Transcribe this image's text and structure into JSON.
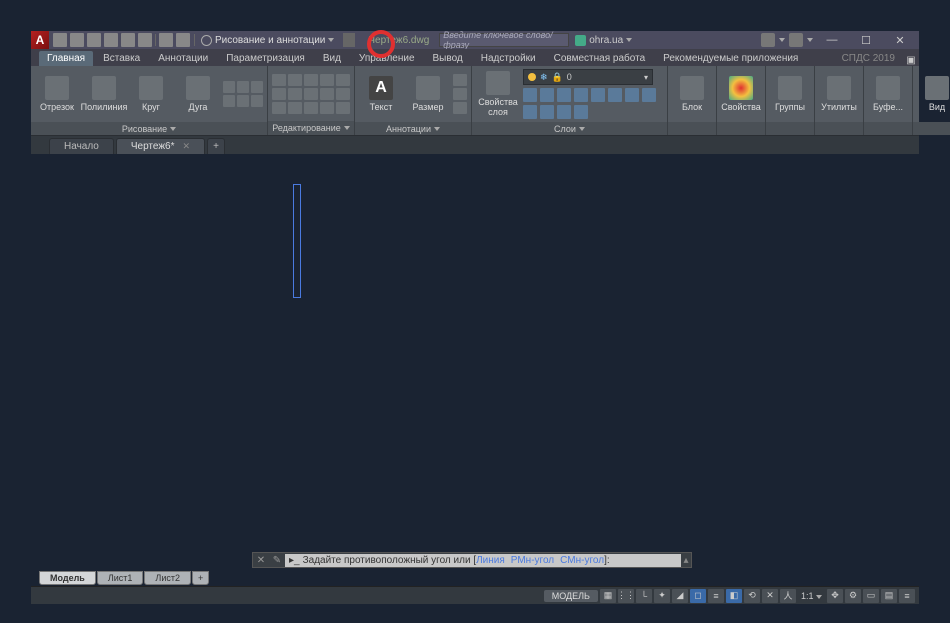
{
  "app_logo": "A",
  "workspace": "Рисование и аннотации",
  "file_name": "Чертеж6.dwg",
  "search_placeholder": "Введите ключевое слово/фразу",
  "user": "ohra.ua",
  "window_buttons": {
    "min": "—",
    "max": "☐",
    "close": "✕"
  },
  "ribbon_tabs": [
    "Главная",
    "Вставка",
    "Аннотации",
    "Параметризация",
    "Вид",
    "Управление",
    "Вывод",
    "Надстройки",
    "Совместная работа",
    "Рекомендуемые приложения"
  ],
  "ribbon_extra": "СПДС 2019",
  "panels": {
    "draw": {
      "title": "Рисование",
      "items": [
        "Отрезок",
        "Полилиния",
        "Круг",
        "Дуга"
      ]
    },
    "edit": {
      "title": "Редактирование"
    },
    "anno": {
      "title": "Аннотации",
      "items": [
        "Текст",
        "Размер"
      ]
    },
    "layer": {
      "title": "Слои",
      "prop": "Свойства слоя",
      "current": "0"
    },
    "block": {
      "title": "Блок",
      "item": "Блок"
    },
    "props": {
      "title": "Свойства",
      "item": "Свойства"
    },
    "groups": {
      "title": "Группы",
      "item": "Группы"
    },
    "utils": {
      "title": "Утилиты",
      "item": "Утилиты"
    },
    "clip": {
      "title": "Буфе...",
      "item": "Буфе..."
    },
    "view": {
      "title": "Вид",
      "item": "Вид"
    }
  },
  "doc_tabs": {
    "start": "Начало",
    "active": "Чертеж6*",
    "plus": "+"
  },
  "command": {
    "prefix": "Задайте противоположный угол или [",
    "opt1": "Линия",
    "opt2": "РМн-угол",
    "opt3": "СМн-угол",
    "suffix": "]:"
  },
  "layout_tabs": [
    "Модель",
    "Лист1",
    "Лист2"
  ],
  "status": {
    "model": "МОДЕЛЬ",
    "scale": "1:1"
  },
  "chart_data": null
}
